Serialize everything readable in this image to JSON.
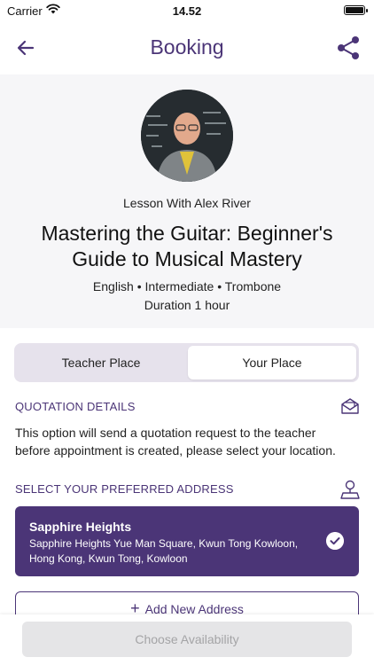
{
  "status_bar": {
    "carrier": "Carrier",
    "time": "14.52",
    "icons": [
      "wifi-icon",
      "battery-icon"
    ]
  },
  "nav": {
    "title": "Booking",
    "icons": [
      "arrow-left-icon",
      "share-icon"
    ]
  },
  "lesson": {
    "teacher_line": "Lesson With Alex River",
    "title": "Mastering the Guitar: Beginner's Guide to Musical Mastery",
    "meta": "English • Intermediate • Trombone",
    "duration": "Duration 1 hour"
  },
  "segment": {
    "options": [
      "Teacher Place",
      "Your Place"
    ],
    "selected": "Your Place"
  },
  "quotation": {
    "heading": "QUOTATION DETAILS",
    "text": "This option will send a quotation request to the teacher before appointment is created, please select your location.",
    "icon": "envelope-icon"
  },
  "address": {
    "heading": "SELECT YOUR PREFERRED ADDRESS",
    "icon": "location-pin-icon",
    "selected": {
      "name": "Sapphire Heights",
      "detail": "Sapphire Heights Yue Man Square, Kwun Tong Kowloon, Hong Kong, Kwun Tong, Kowloon",
      "icon": "checkmark-circle-icon"
    },
    "add_label": "Add New Address",
    "add_icon": "plus-icon"
  },
  "footer": {
    "choose_label": "Choose Availability"
  },
  "colors": {
    "brand_purple": "#4b3577",
    "disabled_bg": "#e5e5e7",
    "disabled_text": "#a4a4a6",
    "segment_bg": "#e6e2ec"
  }
}
